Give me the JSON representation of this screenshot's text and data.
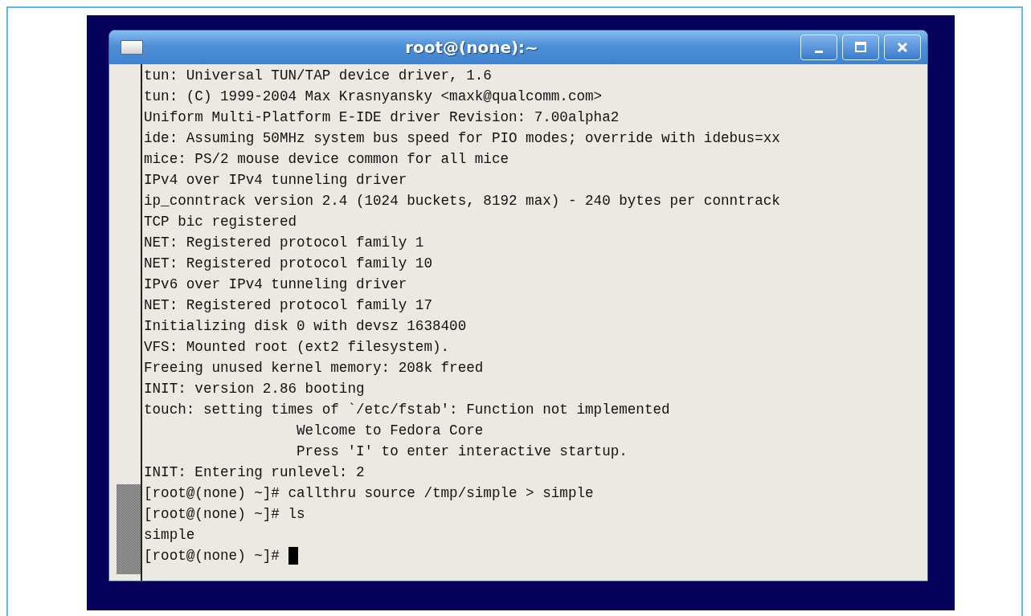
{
  "window": {
    "title": "root@(none):~"
  },
  "terminal": {
    "lines": [
      "tun: Universal TUN/TAP device driver, 1.6",
      "tun: (C) 1999-2004 Max Krasnyansky <maxk@qualcomm.com>",
      "Uniform Multi-Platform E-IDE driver Revision: 7.00alpha2",
      "ide: Assuming 50MHz system bus speed for PIO modes; override with idebus=xx",
      "mice: PS/2 mouse device common for all mice",
      "IPv4 over IPv4 tunneling driver",
      "ip_conntrack version 2.4 (1024 buckets, 8192 max) - 240 bytes per conntrack",
      "TCP bic registered",
      "NET: Registered protocol family 1",
      "NET: Registered protocol family 10",
      "IPv6 over IPv4 tunneling driver",
      "NET: Registered protocol family 17",
      "Initializing disk 0 with devsz 1638400",
      "VFS: Mounted root (ext2 filesystem).",
      "Freeing unused kernel memory: 208k freed",
      "INIT: version 2.86 booting",
      "touch: setting times of `/etc/fstab': Function not implemented",
      "                  Welcome to Fedora Core",
      "                  Press 'I' to enter interactive startup.",
      "INIT: Entering runlevel: 2",
      "[root@(none) ~]# callthru source /tmp/simple > simple",
      "[root@(none) ~]# ls",
      "simple"
    ],
    "prompt": "[root@(none) ~]# "
  }
}
